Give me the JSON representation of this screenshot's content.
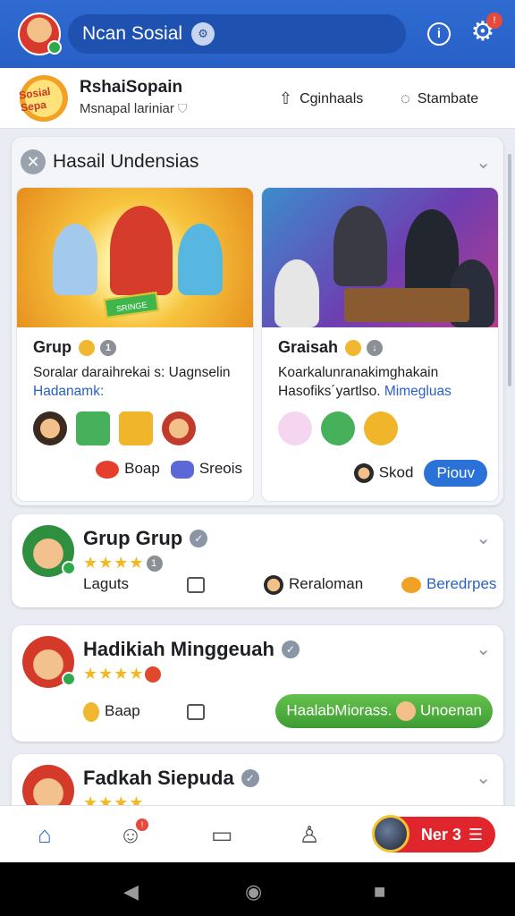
{
  "topbar": {
    "search_label": "Ncan Sosial",
    "settings_badge": "!"
  },
  "profile": {
    "logo_text": "Sosial Sepa",
    "name": "RshaiSopain",
    "subtitle": "Msnapal lariniar",
    "action_1": "Cginhaals",
    "action_2": "Stambate"
  },
  "feature": {
    "title": "Hasail Undensias",
    "cards": [
      {
        "image_sign": "SRINGE",
        "title": "Grup",
        "badge": "1",
        "desc": "Soralar daraihrekai s: Uagnselin",
        "link": "Hadanamk:",
        "foot_1": "Boap",
        "foot_2": "Sreois"
      },
      {
        "title": "Graisah",
        "desc": "Koarkalunranakimghakain Hasofiks´yartlso.",
        "link": "Mimegluas",
        "foot_1": "Skod",
        "cta": "Piouv"
      }
    ]
  },
  "groups": [
    {
      "name": "Grup Grup",
      "rating_badge": "1",
      "stars": "★★★★",
      "item_1": "Laguts",
      "item_2": "Reraloman",
      "item_3": "Beredrpes"
    },
    {
      "name": "Hadikiah Minggeuah",
      "stars": "★★★★",
      "item_1": "Baap",
      "pill_text": "HaalabMiorass.",
      "pill_text_2": "Unoenan"
    },
    {
      "name": "Fadkah Siepuda",
      "stars": "★★★★"
    }
  ],
  "bottomnav": {
    "pill_text": "Ner 3",
    "people_badge": "!"
  },
  "colors": {
    "brand_blue": "#2b6ad2",
    "cta_blue": "#2b72d8",
    "danger_red": "#e0262c",
    "success_green": "#3e9c33"
  }
}
